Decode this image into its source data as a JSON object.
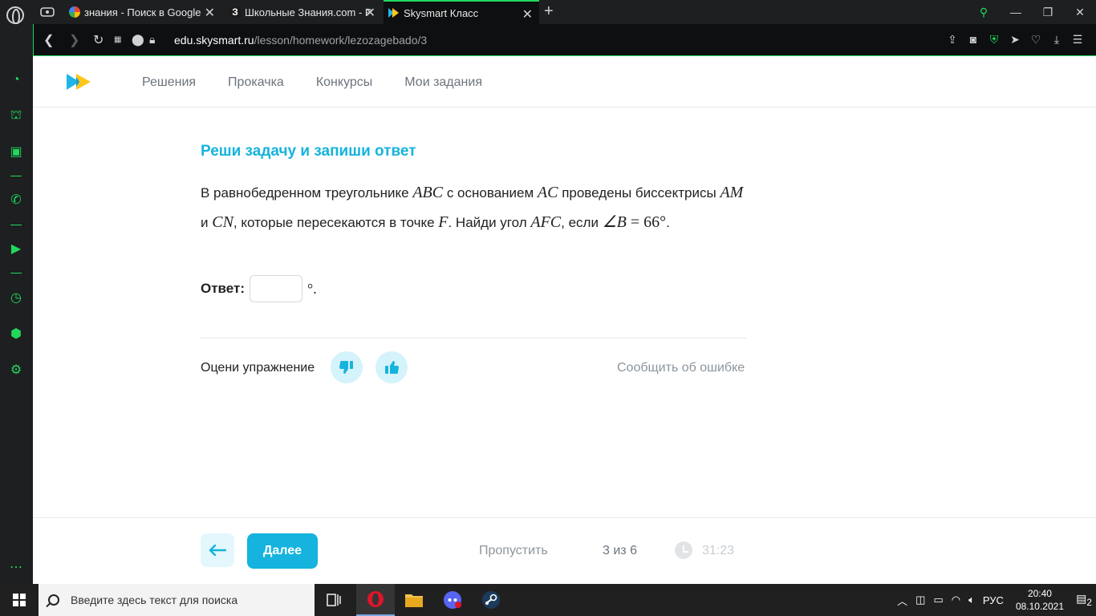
{
  "browser": {
    "tabs": [
      {
        "title": "знания - Поиск в Google",
        "favicon": "google-g-icon"
      },
      {
        "title": "Школьные Знания.com - Р",
        "favicon": "znaniya-icon"
      },
      {
        "title": "Skysmart Класс",
        "favicon": "skysmart-icon"
      }
    ],
    "url_domain": "edu.skysmart.ru",
    "url_path": "/lesson/homework/lezozagebado/3",
    "accent_color": "#21d85c"
  },
  "site": {
    "nav": [
      "Решения",
      "Прокачка",
      "Конкурсы",
      "Мои задания"
    ],
    "brand_color": "#15b3dd"
  },
  "task": {
    "title": "Реши задачу и запиши ответ",
    "text": {
      "t1": "В равнобедренном треугольнике ",
      "m1": "ABC",
      "t2": " с основанием ",
      "m2": "AC",
      "t3": " проведены биссектрисы ",
      "m3": "AM",
      "t4": " и ",
      "m4": "CN",
      "t5": ", которые пересекаются в точке ",
      "m5": "F",
      "t6": ". Найди угол ",
      "m6": "AFC",
      "t7": ", если ",
      "m7": "∠B",
      "m8": " = 66°",
      "t8": "."
    },
    "answer_label": "Ответ:",
    "answer_value": "",
    "answer_suffix": "°."
  },
  "rating": {
    "label": "Оцени упражнение",
    "report": "Сообщить об ошибке"
  },
  "footer": {
    "next": "Далее",
    "skip": "Пропустить",
    "progress": "3 из 6",
    "timer": "31:23"
  },
  "taskbar": {
    "search_placeholder": "Введите здесь текст для поиска",
    "lang": "РУС",
    "time": "20:40",
    "date": "08.10.2021",
    "notifications": "2"
  }
}
